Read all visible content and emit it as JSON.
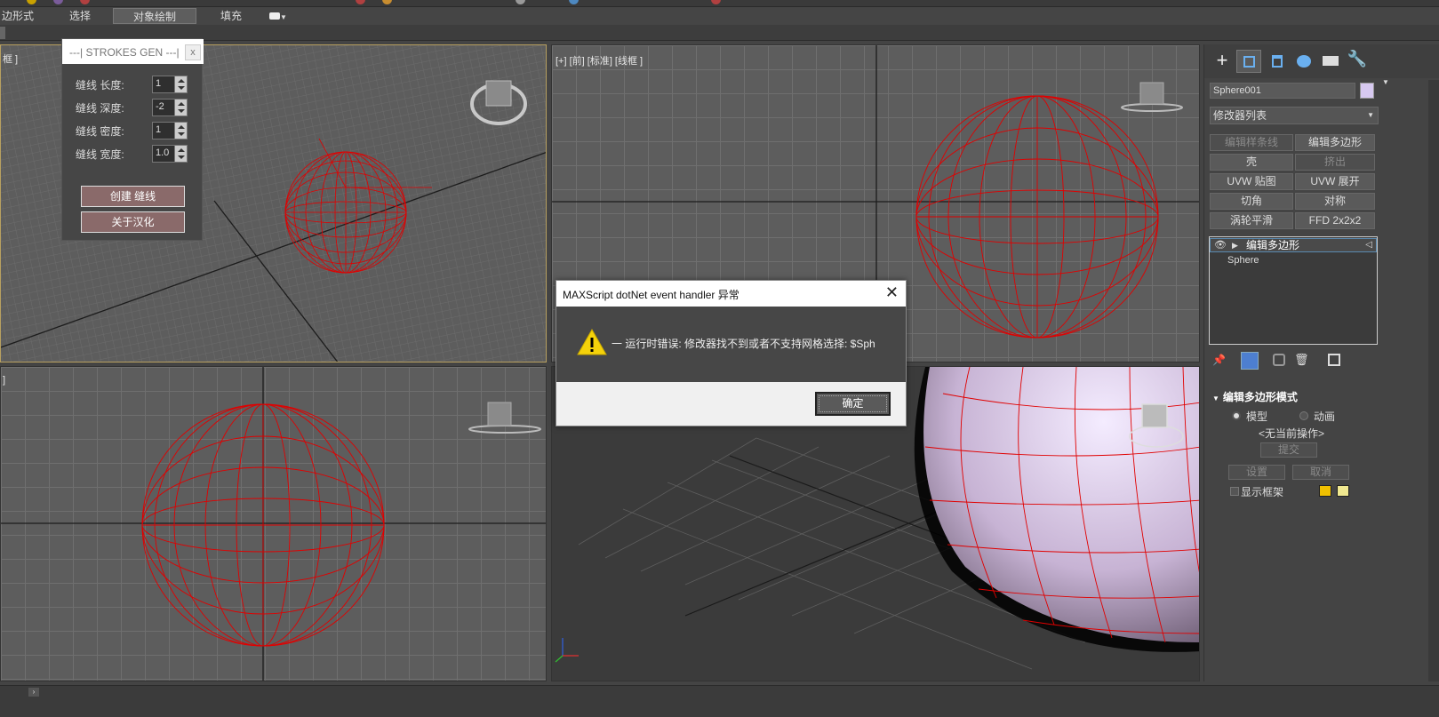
{
  "ribbon": {
    "tabs": [
      "边形式",
      "选择",
      "对象绘制",
      "填充"
    ],
    "active_tab": "对象绘制"
  },
  "viewports": {
    "top_left": {
      "label": "框 ]"
    },
    "top_right": {
      "label": "[+] [前] [标准] [线框 ]"
    },
    "bottom_left": {
      "label": "]"
    }
  },
  "strokes_panel": {
    "title": "---| STROKES GEN ---|",
    "close": "x",
    "fields": [
      {
        "label": "缝线 长度:",
        "value": "1"
      },
      {
        "label": "缝线 深度:",
        "value": "-2"
      },
      {
        "label": "缝线 密度:",
        "value": "1"
      },
      {
        "label": "缝线 宽度:",
        "value": "1.0"
      }
    ],
    "create_button": "创建 缝线",
    "about_button": "关于汉化"
  },
  "dialog": {
    "title": "MAXScript dotNet event handler 异常",
    "message": "一 运行时错误: 修改器找不到或者不支持网格选择: $Sph",
    "ok_button": "确定"
  },
  "command_panel": {
    "object_name": "Sphere001",
    "object_color": "#d7c9f0",
    "modifier_list": "修改器列表",
    "modifier_buttons": [
      {
        "label": "编辑样条线",
        "disabled": true
      },
      {
        "label": "编辑多边形",
        "disabled": false
      },
      {
        "label": "壳",
        "disabled": false
      },
      {
        "label": "挤出",
        "disabled": true
      },
      {
        "label": "UVW 贴图",
        "disabled": false
      },
      {
        "label": "UVW 展开",
        "disabled": false
      },
      {
        "label": "切角",
        "disabled": false
      },
      {
        "label": "对称",
        "disabled": false
      },
      {
        "label": "涡轮平滑",
        "disabled": false
      },
      {
        "label": "FFD 2x2x2",
        "disabled": false
      }
    ],
    "stack": [
      {
        "label": "编辑多边形"
      },
      {
        "label": "Sphere"
      }
    ],
    "rollout": {
      "title": "编辑多边形模式",
      "radio_model": "模型",
      "radio_anim": "动画",
      "status": "<无当前操作>",
      "commit": "提交",
      "settings": "设置",
      "cancel": "取消",
      "show_cage": "显示框架",
      "cage_colors": [
        "#f0c000",
        "#f0e890"
      ]
    }
  },
  "colors": {
    "wire": "#e00000",
    "viewport_bg": "#5d5d5d",
    "active_border": "#b8a060",
    "accent_button": "#8a6a6a"
  }
}
